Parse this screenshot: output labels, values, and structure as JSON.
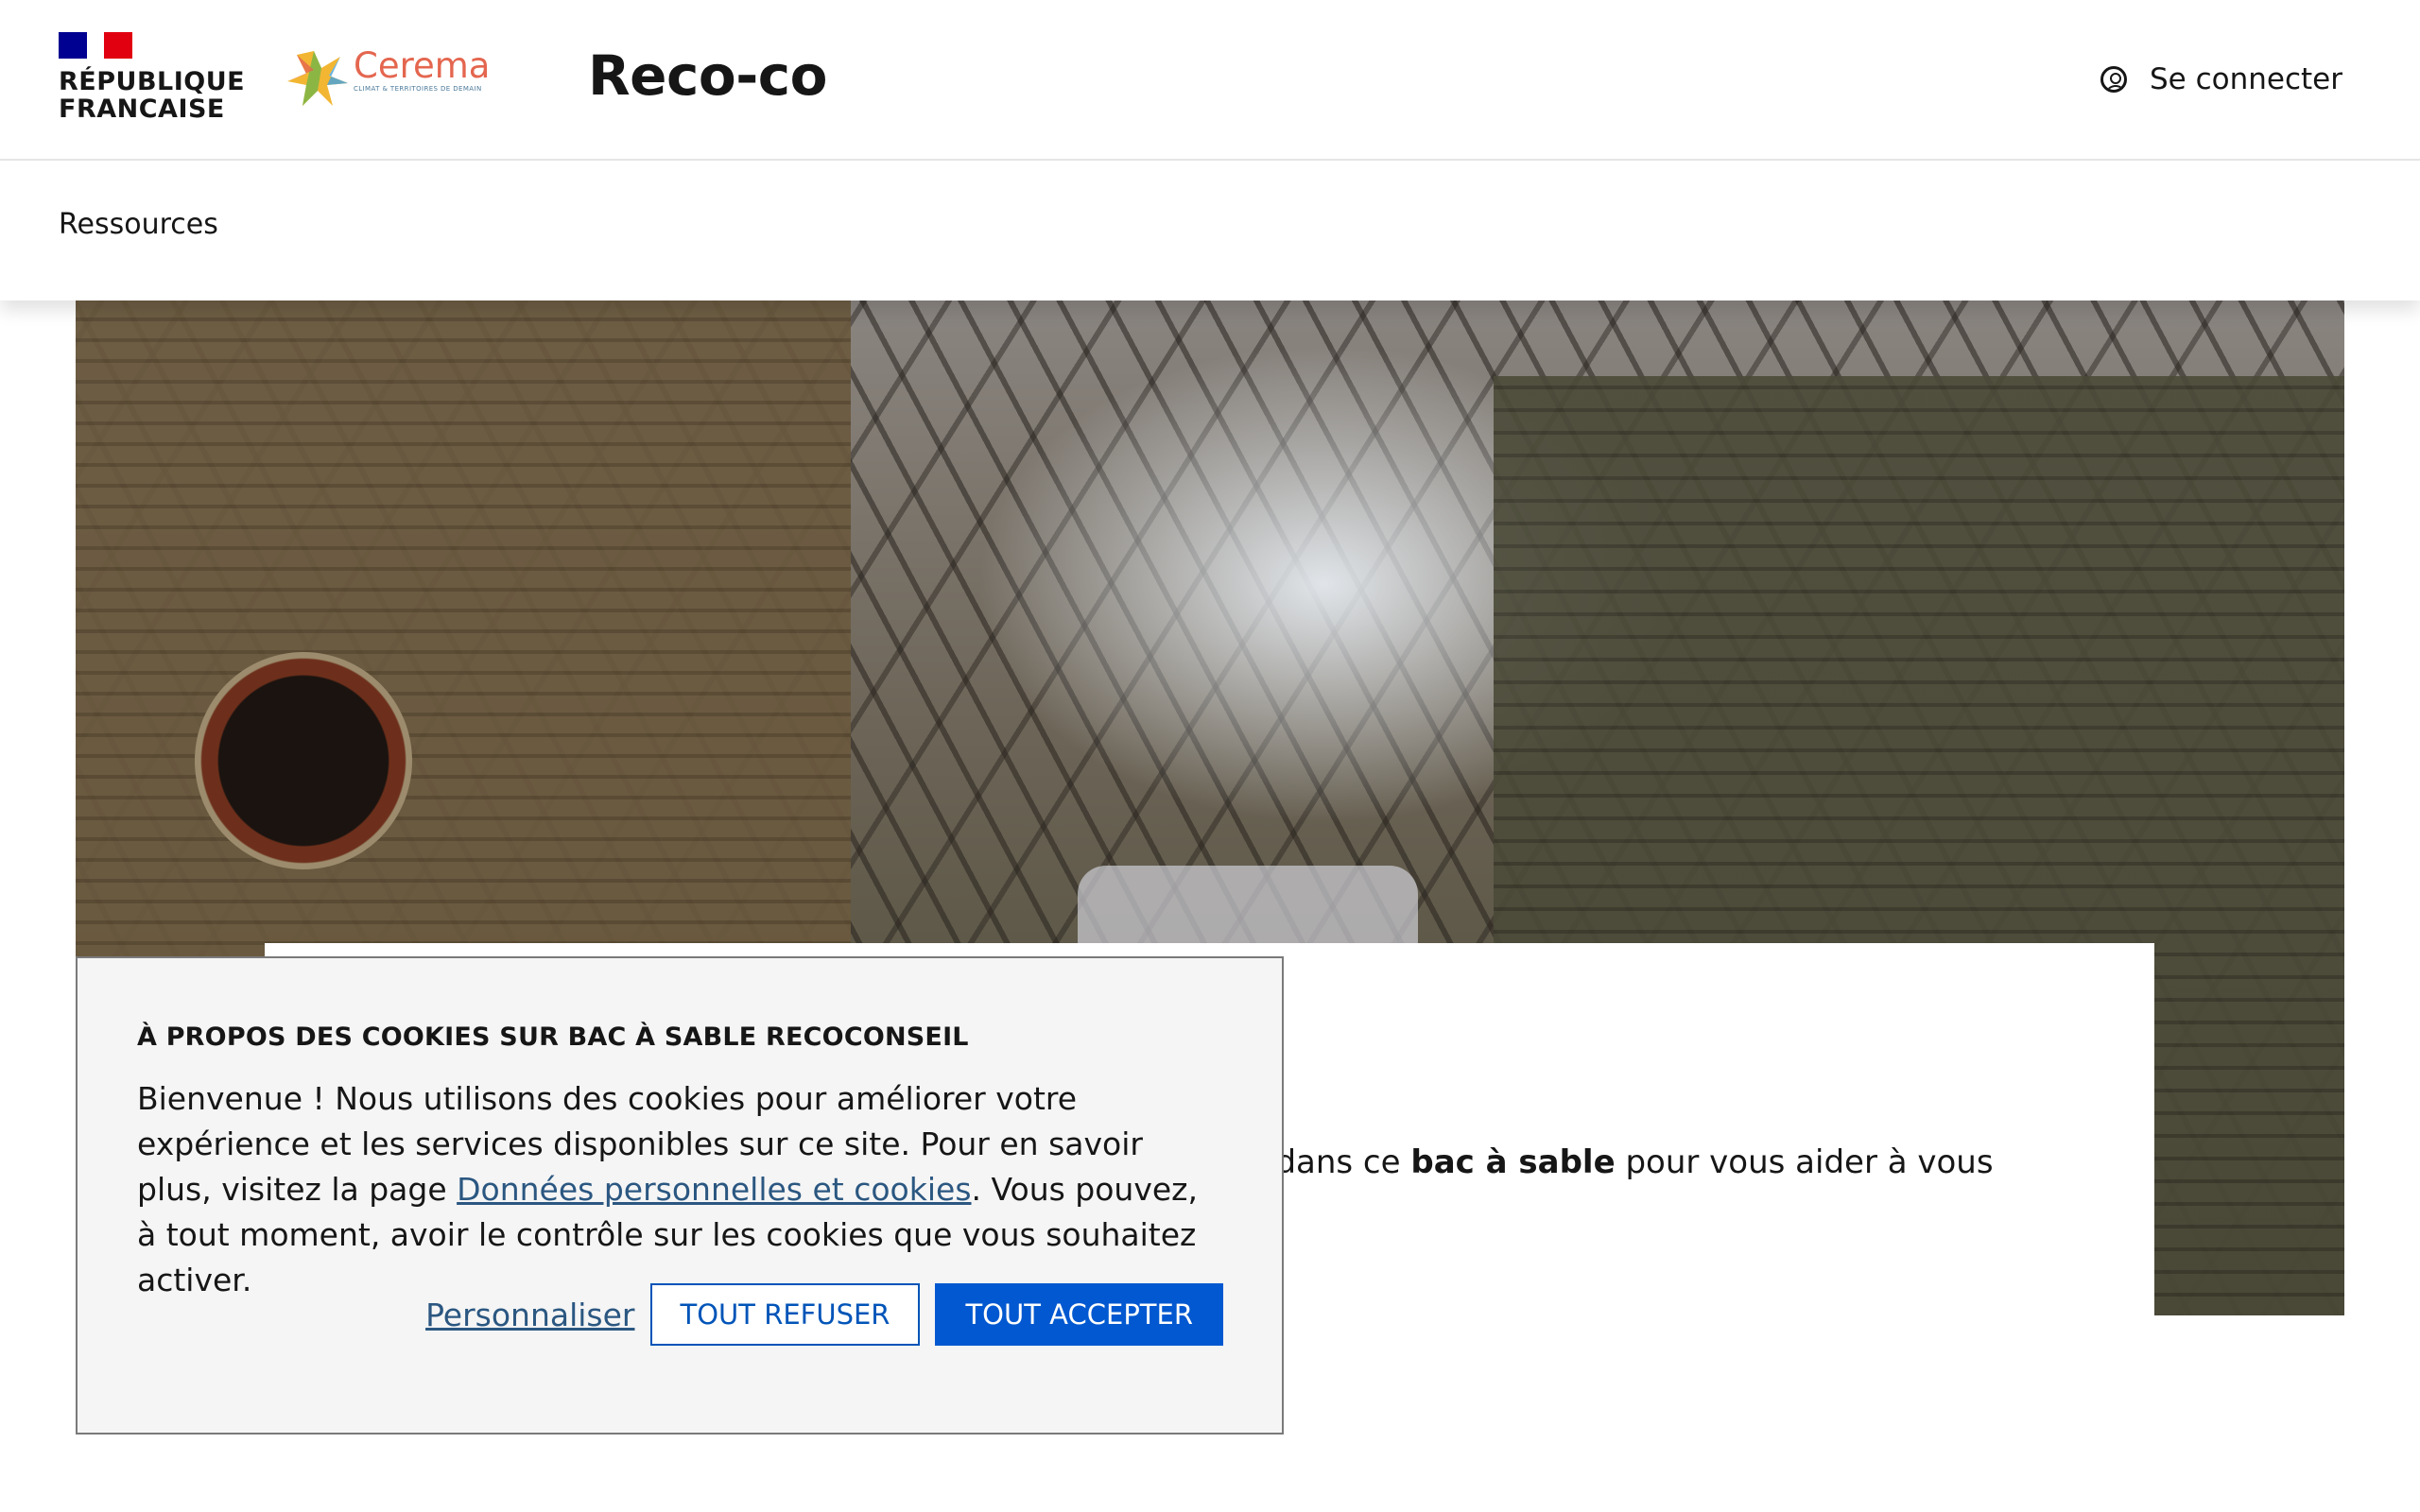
{
  "header": {
    "gov_logo_text": "RÉPUBLIQUE\nFRANCAISE",
    "partner_name": "Cerema",
    "partner_tagline": "CLIMAT & TERRITOIRES DE DEMAIN",
    "site_title": "Reco-co",
    "login_label": "Se connecter",
    "colors": {
      "flag_blue": "#000091",
      "flag_red": "#e1000f",
      "cerema_orange": "#e4664f"
    }
  },
  "nav": {
    "items": [
      {
        "label": "Ressources"
      }
    ]
  },
  "hero": {
    "image_icon": "industrial-hall-photo",
    "text_pre": "es dans ce ",
    "text_bold": "bac à sable",
    "text_post": " pour vous aider à vous"
  },
  "cookie_banner": {
    "title": "À propos des cookies sur Bac à sable Recoconseil",
    "body_pre": "Bienvenue ! Nous utilisons des cookies pour améliorer votre expérience et les services disponibles sur ce site. Pour en savoir plus, visitez la page ",
    "body_link": "Données personnelles et cookies",
    "body_post": ". Vous pouvez, à tout moment, avoir le contrôle sur les cookies que vous souhaitez activer.",
    "customize_label": "Personnaliser",
    "refuse_label": "TOUT REFUSER",
    "accept_label": "TOUT ACCEPTER",
    "colors": {
      "primary": "#0158d0",
      "link": "#2b5781"
    }
  }
}
